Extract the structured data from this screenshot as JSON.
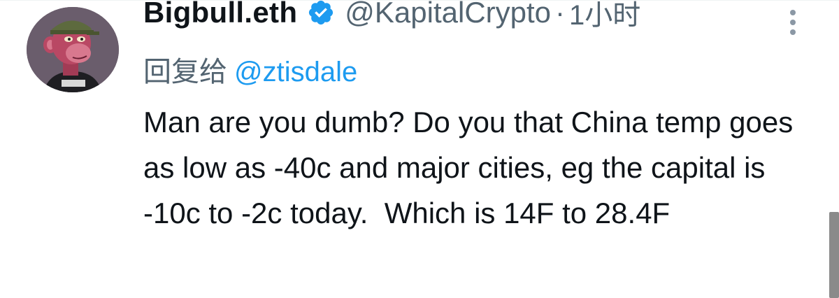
{
  "tweet": {
    "author": {
      "display_name": "Bigbull.eth",
      "handle": "@KapitalCrypto",
      "verified": true,
      "avatar_icon": "bored-ape-avatar"
    },
    "separator": "·",
    "time": "1小时",
    "reply_prefix": "回复给",
    "reply_to": "@ztisdale",
    "text": "Man are you dumb? Do you that China temp goes as low as -40c and major cities, eg the capital is -10c to -2c today.  Which is 14F to 28.4F"
  },
  "colors": {
    "verified_badge": "#1d9bf0",
    "link": "#1d9bf0",
    "secondary_text": "#536471",
    "primary_text": "#0f1419"
  },
  "icons": {
    "verified": "verified-badge-icon",
    "more": "more-options-icon"
  }
}
